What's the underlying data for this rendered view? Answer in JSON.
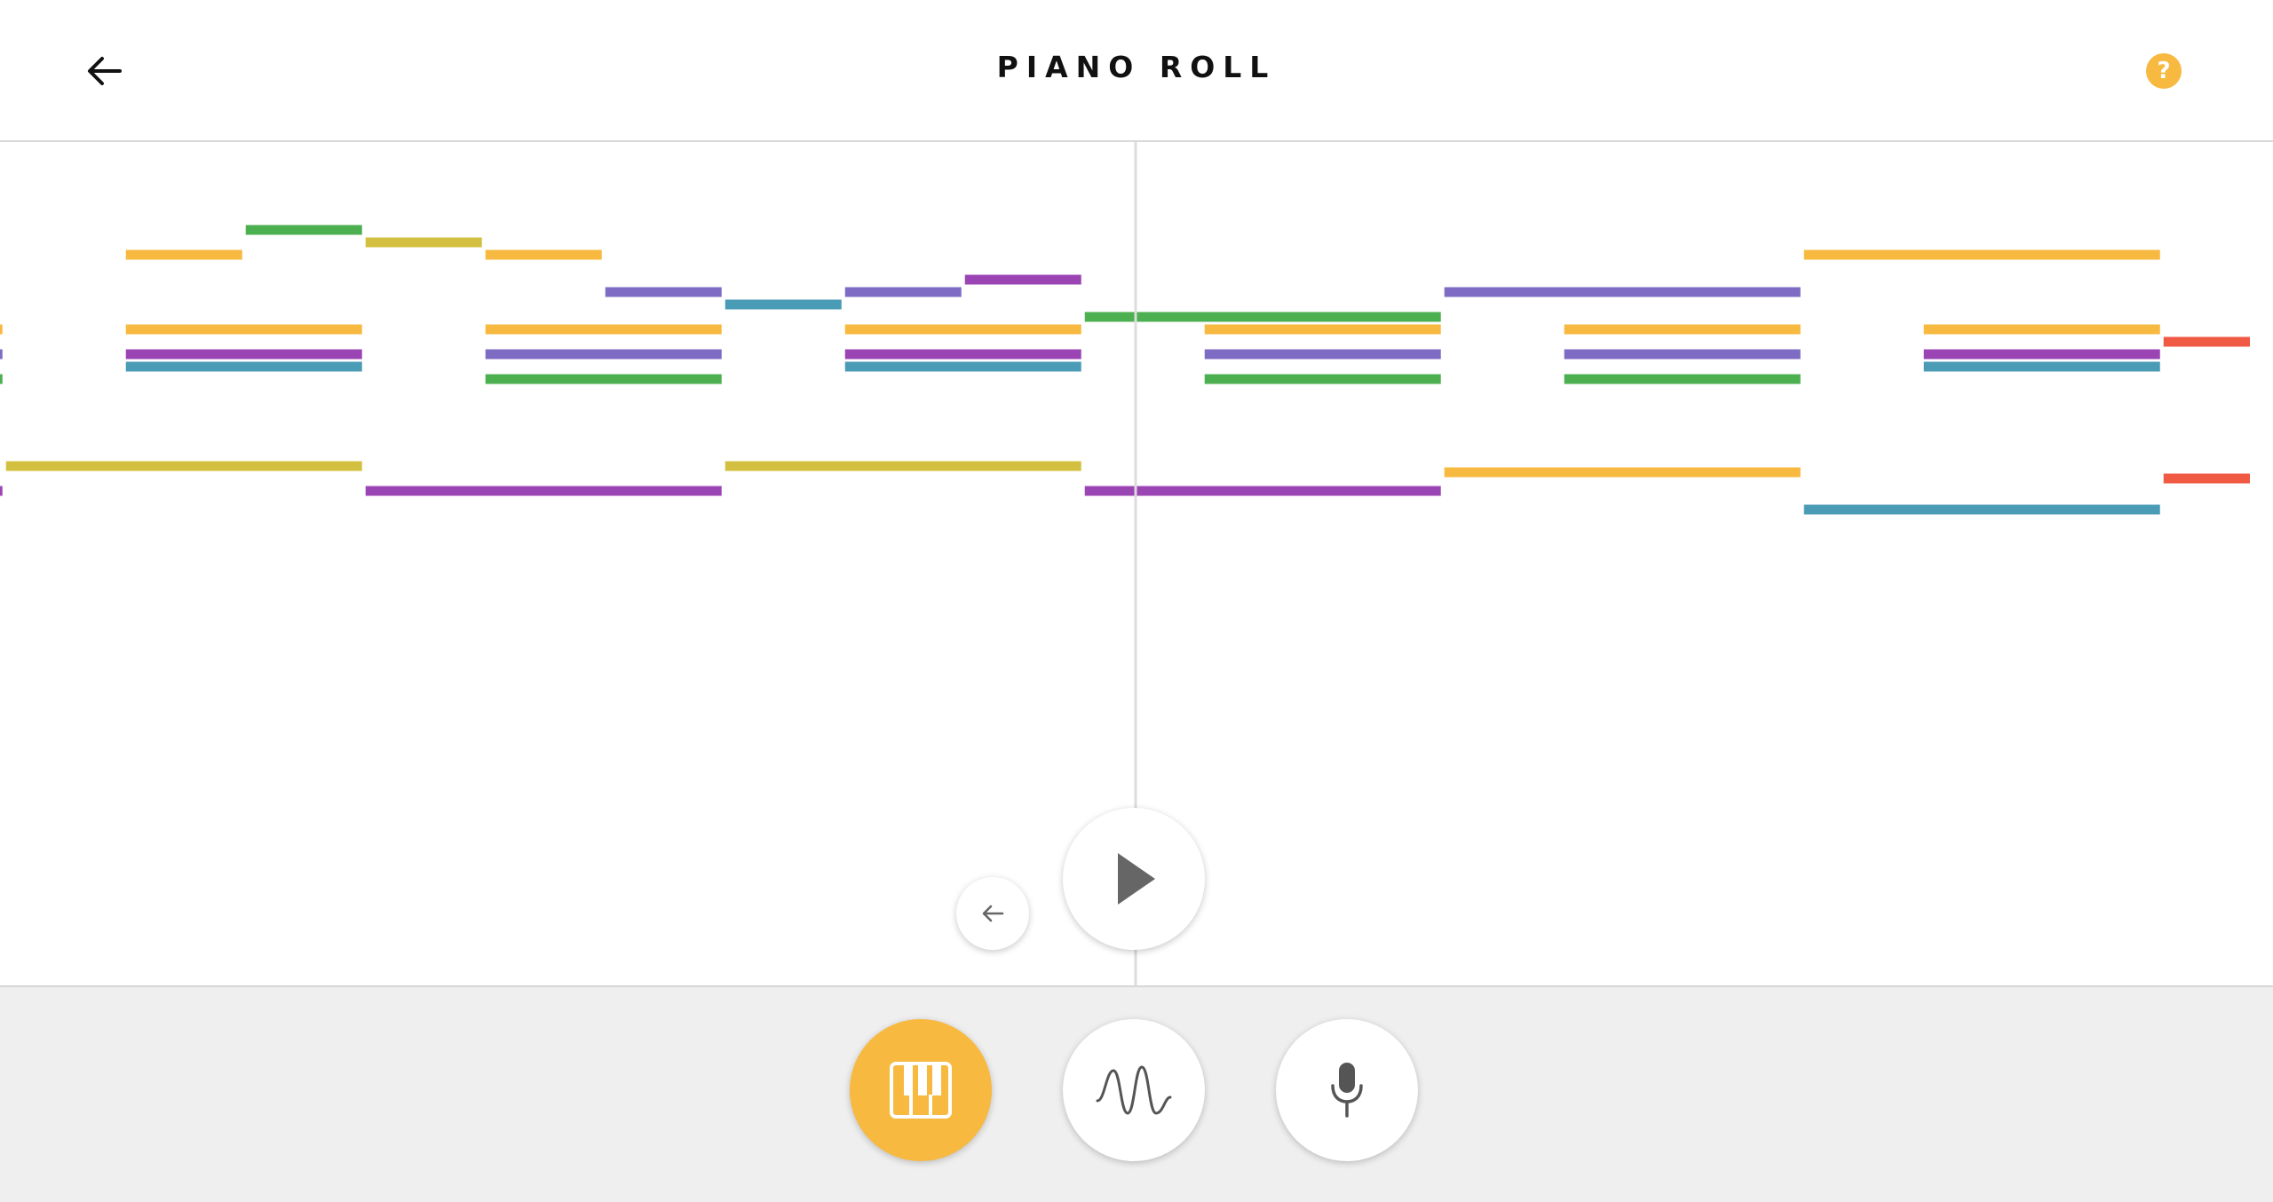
{
  "header": {
    "title": "PIANO ROLL",
    "back_icon": "arrow-left-icon",
    "help_icon": "question-mark-icon",
    "help_glyph": "?",
    "accent_color": "#f7b93f"
  },
  "roll": {
    "playhead_color": "#dcdcdc",
    "colors": {
      "yellow": "#f7b93f",
      "olive": "#d4c040",
      "green": "#4caf50",
      "purple": "#7e6bc4",
      "magenta": "#9b45b5",
      "teal": "#4a9bb5",
      "red": "#f05a45"
    },
    "notes": [
      {
        "start": 0,
        "end": 0.5,
        "pitch": 9,
        "color": "yellow"
      },
      {
        "start": 0,
        "end": 0.5,
        "pitch": 7,
        "color": "purple"
      },
      {
        "start": 0,
        "end": 0.5,
        "pitch": 5,
        "color": "green"
      },
      {
        "start": 0,
        "end": 0.5,
        "pitch": -4,
        "color": "magenta"
      },
      {
        "start": 0.5,
        "end": 6.5,
        "pitch": -2,
        "color": "olive"
      },
      {
        "start": 2.5,
        "end": 4.5,
        "pitch": 15,
        "color": "yellow"
      },
      {
        "start": 2.5,
        "end": 6.5,
        "pitch": 9,
        "color": "yellow"
      },
      {
        "start": 2.5,
        "end": 6.5,
        "pitch": 7,
        "color": "magenta"
      },
      {
        "start": 2.5,
        "end": 6.5,
        "pitch": 6,
        "color": "teal"
      },
      {
        "start": 4.5,
        "end": 6.5,
        "pitch": 17,
        "color": "green"
      },
      {
        "start": 6.5,
        "end": 8.5,
        "pitch": 16,
        "color": "olive"
      },
      {
        "start": 6.5,
        "end": 12.5,
        "pitch": -4,
        "color": "magenta"
      },
      {
        "start": 8.5,
        "end": 10.5,
        "pitch": 15,
        "color": "yellow"
      },
      {
        "start": 8.5,
        "end": 12.5,
        "pitch": 9,
        "color": "yellow"
      },
      {
        "start": 8.5,
        "end": 12.5,
        "pitch": 7,
        "color": "purple"
      },
      {
        "start": 8.5,
        "end": 12.5,
        "pitch": 5,
        "color": "green"
      },
      {
        "start": 10.5,
        "end": 12.5,
        "pitch": 12,
        "color": "purple"
      },
      {
        "start": 12.5,
        "end": 14.5,
        "pitch": 11,
        "color": "teal"
      },
      {
        "start": 12.5,
        "end": 18.5,
        "pitch": -2,
        "color": "olive"
      },
      {
        "start": 14.5,
        "end": 16.5,
        "pitch": 12,
        "color": "purple"
      },
      {
        "start": 14.5,
        "end": 18.5,
        "pitch": 9,
        "color": "yellow"
      },
      {
        "start": 14.5,
        "end": 18.5,
        "pitch": 7,
        "color": "magenta"
      },
      {
        "start": 14.5,
        "end": 18.5,
        "pitch": 6,
        "color": "teal"
      },
      {
        "start": 16.5,
        "end": 18.5,
        "pitch": 13,
        "color": "magenta"
      },
      {
        "start": 18.5,
        "end": 24.5,
        "pitch": 10,
        "color": "green"
      },
      {
        "start": 18.5,
        "end": 24.5,
        "pitch": -4,
        "color": "magenta"
      },
      {
        "start": 20.5,
        "end": 24.5,
        "pitch": 9,
        "color": "yellow"
      },
      {
        "start": 20.5,
        "end": 24.5,
        "pitch": 7,
        "color": "purple"
      },
      {
        "start": 20.5,
        "end": 24.5,
        "pitch": 5,
        "color": "green"
      },
      {
        "start": 24.5,
        "end": 30.5,
        "pitch": 12,
        "color": "purple"
      },
      {
        "start": 24.5,
        "end": 30.5,
        "pitch": -2.5,
        "color": "yellow"
      },
      {
        "start": 26.5,
        "end": 30.5,
        "pitch": 9,
        "color": "yellow"
      },
      {
        "start": 26.5,
        "end": 30.5,
        "pitch": 7,
        "color": "purple"
      },
      {
        "start": 26.5,
        "end": 30.5,
        "pitch": 5,
        "color": "green"
      },
      {
        "start": 30.5,
        "end": 36.5,
        "pitch": 15,
        "color": "yellow"
      },
      {
        "start": 30.5,
        "end": 36.5,
        "pitch": -5.5,
        "color": "teal"
      },
      {
        "start": 32.5,
        "end": 36.5,
        "pitch": 9,
        "color": "yellow"
      },
      {
        "start": 32.5,
        "end": 36.5,
        "pitch": 7,
        "color": "magenta"
      },
      {
        "start": 32.5,
        "end": 36.5,
        "pitch": 6,
        "color": "teal"
      },
      {
        "start": 36.5,
        "end": 38,
        "pitch": 8,
        "color": "red"
      },
      {
        "start": 36.5,
        "end": 38,
        "pitch": -3,
        "color": "red"
      }
    ]
  },
  "controls": {
    "play_icon": "play-icon",
    "rewind_icon": "arrow-left-small-icon",
    "icon_color": "#666666"
  },
  "modes": [
    {
      "name": "piano",
      "icon": "piano-keys-icon",
      "active": true
    },
    {
      "name": "waveform",
      "icon": "sine-wave-icon",
      "active": false
    },
    {
      "name": "microphone",
      "icon": "microphone-icon",
      "active": false
    }
  ]
}
